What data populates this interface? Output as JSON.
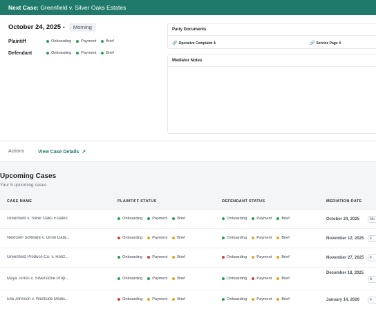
{
  "header": {
    "prefix": "Next Case:",
    "case_name": "Greenfield v. Silver Oaks Estates"
  },
  "next_case": {
    "date": "October 24, 2025 -",
    "session": "Morning",
    "parties": [
      {
        "label": "Plaintiff",
        "statuses": [
          {
            "label": "Onboarding",
            "color": "green"
          },
          {
            "label": "Payment",
            "color": "green"
          },
          {
            "label": "Brief",
            "color": "green"
          }
        ]
      },
      {
        "label": "Defendant",
        "statuses": [
          {
            "label": "Onboarding",
            "color": "green"
          },
          {
            "label": "Payment",
            "color": "green"
          },
          {
            "label": "Brief",
            "color": "green"
          }
        ]
      }
    ],
    "documents_title": "Party Documents",
    "documents": [
      {
        "label": "Operative Complaint",
        "icon": "link-icon",
        "action_icon": "download-icon"
      },
      {
        "label": "Service Page",
        "icon": "link-icon",
        "action_icon": "download-icon"
      }
    ],
    "notes_title": "Mediator Notes",
    "actions_label": "Actions",
    "view_link": "View Case Details",
    "view_link_icon": "external-arrow-icon"
  },
  "upcoming": {
    "title": "Upcoming Cases",
    "subtitle": "Your 5 upcoming cases",
    "columns": [
      "CASE NAME",
      "PLAINTIFF STATUS",
      "DEFENDANT STATUS",
      "MEDIATION DATE"
    ],
    "rows": [
      {
        "name": "Greenfield v. Silver Oaks Estates",
        "plaintiff": [
          {
            "label": "Onboarding",
            "color": "green"
          },
          {
            "label": "Payment",
            "color": "green"
          },
          {
            "label": "Brief",
            "color": "green"
          }
        ],
        "defendant": [
          {
            "label": "Onboarding",
            "color": "green"
          },
          {
            "label": "Payment",
            "color": "green"
          },
          {
            "label": "Brief",
            "color": "green"
          }
        ],
        "date": "October 24, 2025",
        "badge": "Mo"
      },
      {
        "name": "NextGen Software v. Orion Data...",
        "plaintiff": [
          {
            "label": "Onboarding",
            "color": "red"
          },
          {
            "label": "Payment",
            "color": "orange"
          },
          {
            "label": "Brief",
            "color": "orange"
          }
        ],
        "defendant": [
          {
            "label": "Onboarding",
            "color": "green"
          },
          {
            "label": "Payment",
            "color": "orange"
          },
          {
            "label": "Brief",
            "color": "orange"
          }
        ],
        "date": "November 12, 2025",
        "badge": "F"
      },
      {
        "name": "Greenfield Produce Co. v. Horiz...",
        "plaintiff": [
          {
            "label": "Onboarding",
            "color": "green"
          },
          {
            "label": "Payment",
            "color": "red"
          },
          {
            "label": "Brief",
            "color": "orange"
          }
        ],
        "defendant": [
          {
            "label": "Onboarding",
            "color": "red"
          },
          {
            "label": "Payment",
            "color": "orange"
          },
          {
            "label": "Brief",
            "color": "orange"
          }
        ],
        "date": "November 27, 2025",
        "badge": "F"
      },
      {
        "name": "Maya Torres v. Silverstone Prop...",
        "plaintiff": [
          {
            "label": "Onboarding",
            "color": "green"
          },
          {
            "label": "Payment",
            "color": "green"
          },
          {
            "label": "Brief",
            "color": "orange"
          }
        ],
        "defendant": [
          {
            "label": "Onboarding",
            "color": "green"
          },
          {
            "label": "Payment",
            "color": "red"
          },
          {
            "label": "Brief",
            "color": "orange"
          }
        ],
        "date": "December 18, 2025",
        "badge": "A"
      },
      {
        "name": "Ella Johnson v. Westside Medic...",
        "plaintiff": [
          {
            "label": "Onboarding",
            "color": "red"
          },
          {
            "label": "Payment",
            "color": "orange"
          },
          {
            "label": "Brief",
            "color": "orange"
          }
        ],
        "defendant": [
          {
            "label": "Onboarding",
            "color": "green"
          },
          {
            "label": "Payment",
            "color": "orange"
          },
          {
            "label": "Brief",
            "color": "orange"
          }
        ],
        "date": "January 14, 2026",
        "badge": "F"
      }
    ]
  },
  "colors": {
    "accent": "#1f7a69",
    "green": "#22a150",
    "orange": "#e6a317",
    "red": "#e03a3a"
  }
}
